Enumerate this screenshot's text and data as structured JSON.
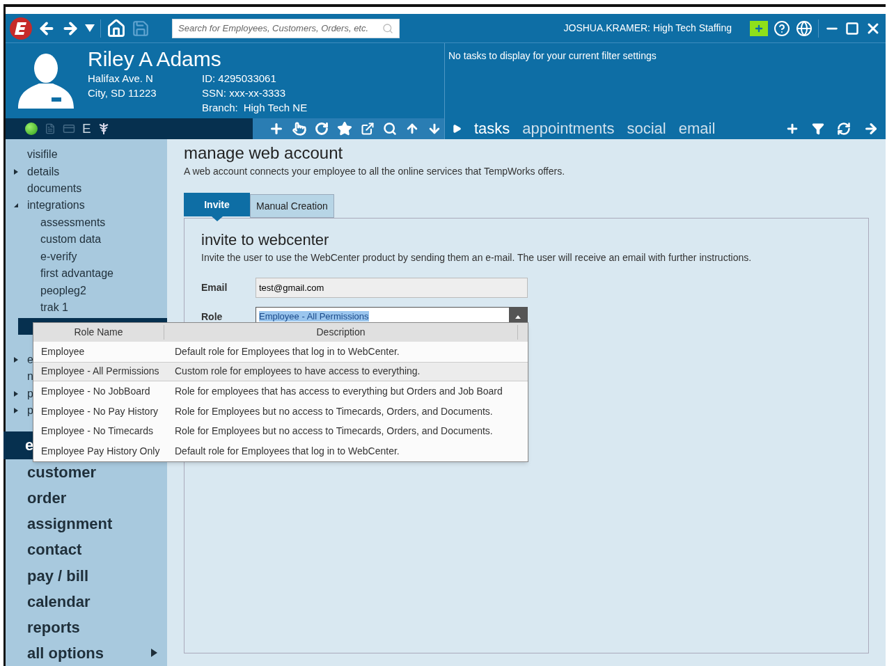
{
  "toolbar": {
    "search": {
      "placeholder": "Search for Employees, Customers, Orders, etc."
    },
    "user": "JOSHUA.KRAMER: High Tech Staffing"
  },
  "profile": {
    "name": "Riley A Adams",
    "address_1": "Halifax Ave. N",
    "address_2": "City, SD 11223",
    "id": "ID: 4295033061",
    "ssn": "SSN: xxx-xx-3333",
    "branch_label": "Branch:",
    "branch": "High Tech NE",
    "status_letter": "E"
  },
  "tasks": {
    "message": "No tasks to display for your current filter settings",
    "tabs": [
      {
        "label": "tasks",
        "selected": true
      },
      {
        "label": "appointments",
        "selected": false
      },
      {
        "label": "social",
        "selected": false
      },
      {
        "label": "email",
        "selected": false
      }
    ]
  },
  "sidebar": {
    "items": [
      {
        "label": "visifile",
        "selected": false
      },
      {
        "label": "details",
        "expanded": false,
        "selected": false
      },
      {
        "label": "documents",
        "selected": false
      },
      {
        "label": "integrations",
        "expanded": true,
        "selected": false,
        "children": [
          {
            "label": "assessments"
          },
          {
            "label": "custom data"
          },
          {
            "label": "e-verify"
          },
          {
            "label": "first advantage"
          },
          {
            "label": "peopleg2"
          },
          {
            "label": "trak 1"
          }
        ]
      },
      {
        "selected": true
      },
      {
        "label": "e",
        "expanded": false,
        "selected": false
      },
      {
        "label": "n",
        "selected": false
      },
      {
        "label": "p",
        "expanded": false,
        "selected": false
      },
      {
        "label": "p",
        "expanded": false,
        "selected": false
      }
    ],
    "section": "e",
    "sections": [
      {
        "label": "customer"
      },
      {
        "label": "order"
      },
      {
        "label": "assignment"
      },
      {
        "label": "contact"
      },
      {
        "label": "pay / bill"
      },
      {
        "label": "calendar"
      },
      {
        "label": "reports"
      },
      {
        "label": "all options",
        "submenu": true
      }
    ]
  },
  "page": {
    "title": "manage web account",
    "description": "A web account connects your employee to all the online services that TempWorks offers.",
    "tabs": [
      {
        "label": "Invite",
        "selected": true
      },
      {
        "label": "Manual Creation",
        "selected": false
      }
    ],
    "section_title": "invite to webcenter",
    "section_description": "Invite the user to use the WebCenter product by sending them an e-mail. The user will receive an email with further instructions.",
    "email": {
      "label": "Email",
      "value": "test@gmail.com"
    },
    "role": {
      "label": "Role",
      "value": "Employee - All Permissions",
      "expanded": true
    }
  },
  "dropdown": {
    "columns": [
      "Role Name",
      "Description"
    ],
    "rows": [
      {
        "name": "Employee",
        "description": "Default role for Employees that log in to WebCenter.",
        "selected": false
      },
      {
        "name": "Employee - All Permissions",
        "description": "Custom role for employees to have access to everything.",
        "selected": true
      },
      {
        "name": "Employee - No JobBoard",
        "description": "Role for employees that has access to everything but Orders and Job Board",
        "selected": false
      },
      {
        "name": "Employee - No Pay History",
        "description": "Role for Employees but no access to Timecards, Orders, and Documents.",
        "selected": false
      },
      {
        "name": "Employee - No Timecards",
        "description": "Role for Employees but no access to Timecards, Orders, and Documents.",
        "selected": false
      },
      {
        "name": "Employee Pay History Only",
        "description": "Default role for Employees that log in to WebCenter.",
        "selected": false
      }
    ]
  }
}
